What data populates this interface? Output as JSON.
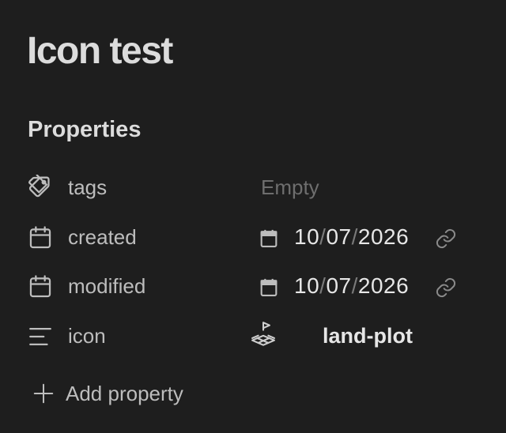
{
  "note": {
    "title": "Icon test"
  },
  "properties": {
    "heading": "Properties",
    "rows": [
      {
        "icon": "tag-icon",
        "key": "tags",
        "value": "Empty"
      },
      {
        "icon": "calendar-icon",
        "key": "created",
        "date": {
          "day": "10",
          "month": "07",
          "year": "2026",
          "sep": "/"
        }
      },
      {
        "icon": "calendar-icon",
        "key": "modified",
        "date": {
          "day": "10",
          "month": "07",
          "year": "2026",
          "sep": "/"
        }
      },
      {
        "icon": "text-align-left-icon",
        "key": "icon",
        "value_icon": "land-plot-icon",
        "value": "land-plot"
      }
    ],
    "add_label": "Add property"
  },
  "colors": {
    "background": "#1e1e1e",
    "text": "#dadada",
    "muted": "#6e6e6e"
  }
}
